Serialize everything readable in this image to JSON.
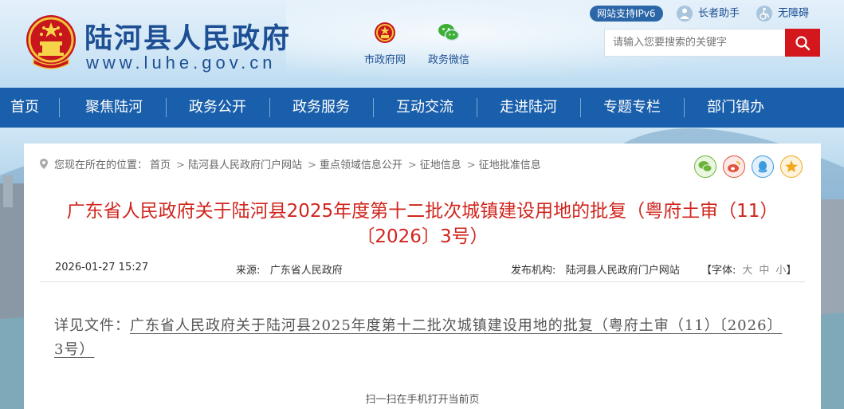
{
  "header": {
    "site_name": "陆河县人民政府",
    "site_url": "www.luhe.gov.cn",
    "quick_links": [
      {
        "label": "市政府网",
        "icon": "emblem-icon"
      },
      {
        "label": "政务微信",
        "icon": "wechat-icon"
      }
    ],
    "ipv6_badge": "网站支持IPv6",
    "elder_mode": "长者助手",
    "accessibility": "无障碍",
    "search_placeholder": "请输入您要搜索的关键字"
  },
  "nav": {
    "items": [
      "首页",
      "聚焦陆河",
      "政务公开",
      "政务服务",
      "互动交流",
      "走进陆河",
      "专题专栏",
      "部门镇办"
    ]
  },
  "breadcrumb": {
    "prefix": "您现在所在的位置：",
    "items": [
      "首页",
      "陆河县人民政府门户网站",
      "重点领域信息公开",
      "征地信息",
      "征地批准信息"
    ],
    "separator": ">"
  },
  "share": [
    "wechat-share-icon",
    "weibo-share-icon",
    "qq-share-icon",
    "favorite-icon"
  ],
  "article": {
    "title_line1": "广东省人民政府关于陆河县2025年度第十二批次城镇建设用地的批复（粤府土审（11）",
    "title_line2": "〔2026〕3号）",
    "date": "2026-01-27 15:27",
    "source_label": "来源:",
    "source": "广东省人民政府",
    "publisher_label": "发布机构:",
    "publisher": "陆河县人民政府门户网站",
    "font_label": "【字体:",
    "font_sizes": [
      "大",
      "中",
      "小"
    ],
    "font_close": "】",
    "detail_prefix": "详见文件：",
    "detail_link": "广东省人民政府关于陆河县2025年度第十二批次城镇建设用地的批复（粤府土审（11）〔2026〕3号）",
    "qr_tip": "扫一扫在手机打开当前页"
  },
  "colors": {
    "nav_blue": "#1a5fab",
    "brand_blue": "#1c4f93",
    "title_red": "#d0261e",
    "search_red": "#d3171c"
  }
}
